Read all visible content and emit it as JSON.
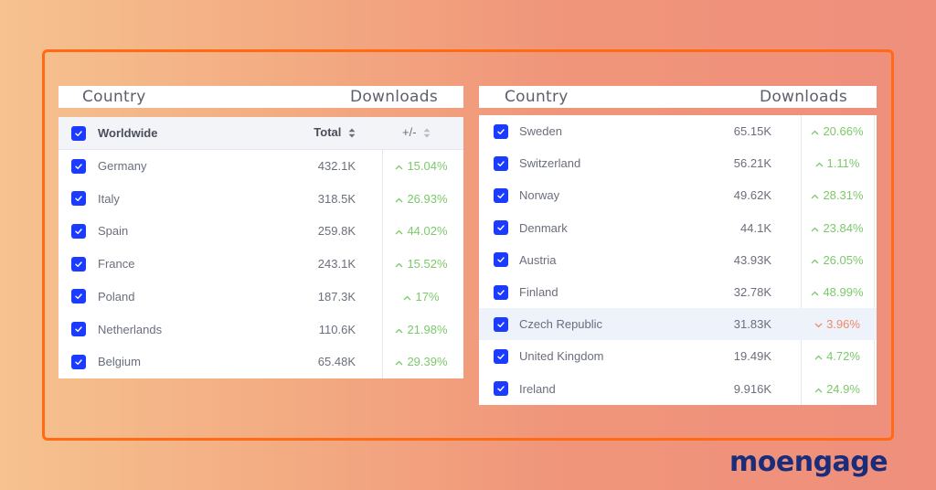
{
  "left_panel": {
    "header": {
      "country": "Country",
      "downloads": "Downloads"
    },
    "table_header": {
      "name": "Worldwide",
      "total": "Total",
      "change": "+/-"
    },
    "rows": [
      {
        "country": "Germany",
        "downloads": "432.1K",
        "change": "15.04%",
        "trend": "up"
      },
      {
        "country": "Italy",
        "downloads": "318.5K",
        "change": "26.93%",
        "trend": "up"
      },
      {
        "country": "Spain",
        "downloads": "259.8K",
        "change": "44.02%",
        "trend": "up"
      },
      {
        "country": "France",
        "downloads": "243.1K",
        "change": "15.52%",
        "trend": "up"
      },
      {
        "country": "Poland",
        "downloads": "187.3K",
        "change": "17%",
        "trend": "up"
      },
      {
        "country": "Netherlands",
        "downloads": "110.6K",
        "change": "21.98%",
        "trend": "up"
      },
      {
        "country": "Belgium",
        "downloads": "65.48K",
        "change": "29.39%",
        "trend": "up"
      }
    ]
  },
  "right_panel": {
    "header": {
      "country": "Country",
      "downloads": "Downloads"
    },
    "rows": [
      {
        "country": "Sweden",
        "downloads": "65.15K",
        "change": "20.66%",
        "trend": "up"
      },
      {
        "country": "Switzerland",
        "downloads": "56.21K",
        "change": "1.11%",
        "trend": "up"
      },
      {
        "country": "Norway",
        "downloads": "49.62K",
        "change": "28.31%",
        "trend": "up"
      },
      {
        "country": "Denmark",
        "downloads": "44.1K",
        "change": "23.84%",
        "trend": "up"
      },
      {
        "country": "Austria",
        "downloads": "43.93K",
        "change": "26.05%",
        "trend": "up"
      },
      {
        "country": "Finland",
        "downloads": "32.78K",
        "change": "48.99%",
        "trend": "up"
      },
      {
        "country": "Czech Republic",
        "downloads": "31.83K",
        "change": "3.96%",
        "trend": "down"
      },
      {
        "country": "United Kingdom",
        "downloads": "19.49K",
        "change": "4.72%",
        "trend": "up"
      },
      {
        "country": "Ireland",
        "downloads": "9.916K",
        "change": "24.9%",
        "trend": "up"
      }
    ]
  },
  "icons": {
    "up": "chevron-up-icon",
    "down": "chevron-down-icon",
    "sort": "sort-icon",
    "checkbox": "checkbox-checked-icon"
  },
  "colors": {
    "accent": "#1b3cff",
    "positive": "#7cc96b",
    "negative": "#f08a6a",
    "frame": "#ff6a12",
    "brand": "#1b2d7a"
  },
  "brand": {
    "logo_text": "moengage"
  }
}
